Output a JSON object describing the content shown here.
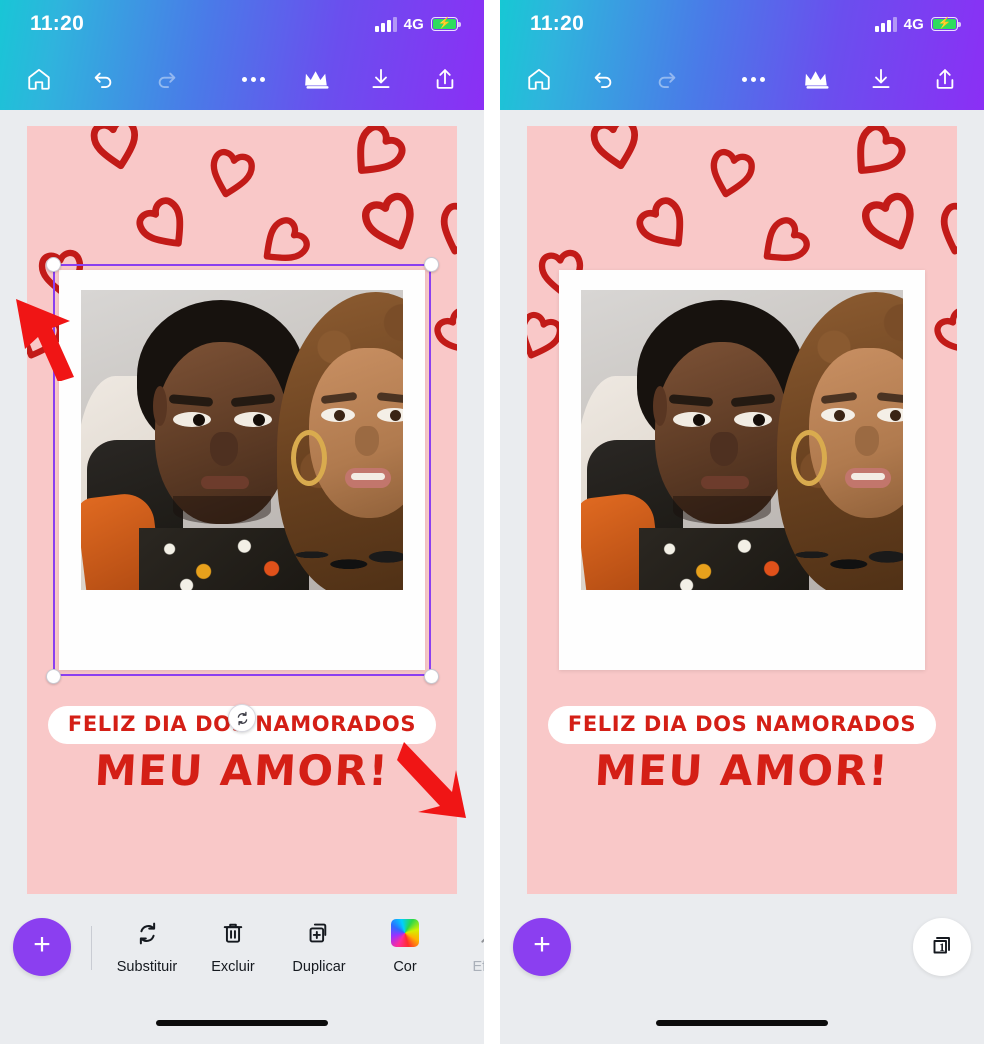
{
  "app": {
    "name": "Canva mobile editor",
    "accent_color": "#8b3ff0",
    "header_gradient_from": "#18c6d6",
    "header_gradient_to": "#8b2ff5",
    "canvas_background": "#f9c8c8",
    "app_background": "#eaecef",
    "heart_color": "#c21b18",
    "text_color": "#d41f16",
    "selection_color": "#8b3ff0",
    "annotation_arrow_color": "#f01515"
  },
  "status_bar": {
    "time": "11:20",
    "network": "4G",
    "signal_icon": "signal-bars-icon",
    "battery_icon": "battery-charging-icon",
    "battery_charging": true
  },
  "toolbar": {
    "left": [
      {
        "name": "home-icon",
        "label": "Home",
        "enabled": true
      },
      {
        "name": "undo-icon",
        "label": "Desfazer",
        "enabled": true
      },
      {
        "name": "redo-icon",
        "label": "Refazer",
        "enabled": false
      }
    ],
    "right": [
      {
        "name": "more-icon",
        "label": "Mais",
        "enabled": true
      },
      {
        "name": "crown-icon",
        "label": "Pro",
        "enabled": true
      },
      {
        "name": "download-icon",
        "label": "Baixar",
        "enabled": true
      },
      {
        "name": "share-icon",
        "label": "Compartilhar",
        "enabled": true
      }
    ]
  },
  "design": {
    "background_color": "#f9c8c8",
    "pattern": "hand-drawn hearts",
    "photo": {
      "style": "polaroid",
      "alt": "Casal abraçado"
    },
    "text": {
      "line1": "FELIZ DIA DOS NAMORADOS",
      "line2": "MEU AMOR!"
    }
  },
  "selection": {
    "active": true,
    "element": "photo-frame",
    "handles": [
      "top-left",
      "top-right",
      "bottom-left",
      "bottom-right"
    ],
    "rotate_handle_icon": "rotate-icon"
  },
  "annotations": [
    {
      "name": "arrow-top-left",
      "direction": "up-left",
      "points_to": "top-left-resize-handle"
    },
    {
      "name": "arrow-bottom-right",
      "direction": "down-right",
      "points_to": "bottom-right-resize-handle"
    }
  ],
  "bottom_bar": {
    "add_button_label": "+",
    "add_button_name": "add-element-button",
    "actions": [
      {
        "label": "Substituir",
        "icon": "replace-icon",
        "enabled": true
      },
      {
        "label": "Excluir",
        "icon": "trash-icon",
        "enabled": true
      },
      {
        "label": "Duplicar",
        "icon": "duplicate-icon",
        "enabled": true
      },
      {
        "label": "Cor",
        "icon": "color-swatch-icon",
        "enabled": true
      },
      {
        "label": "Efeito",
        "icon": "effects-icon",
        "enabled": false
      }
    ],
    "pages_button": {
      "icon": "pages-icon",
      "count": "1"
    }
  },
  "panels": [
    {
      "name": "left-screenshot",
      "state": "photo selected with resize handles"
    },
    {
      "name": "right-screenshot",
      "state": "nothing selected"
    }
  ]
}
